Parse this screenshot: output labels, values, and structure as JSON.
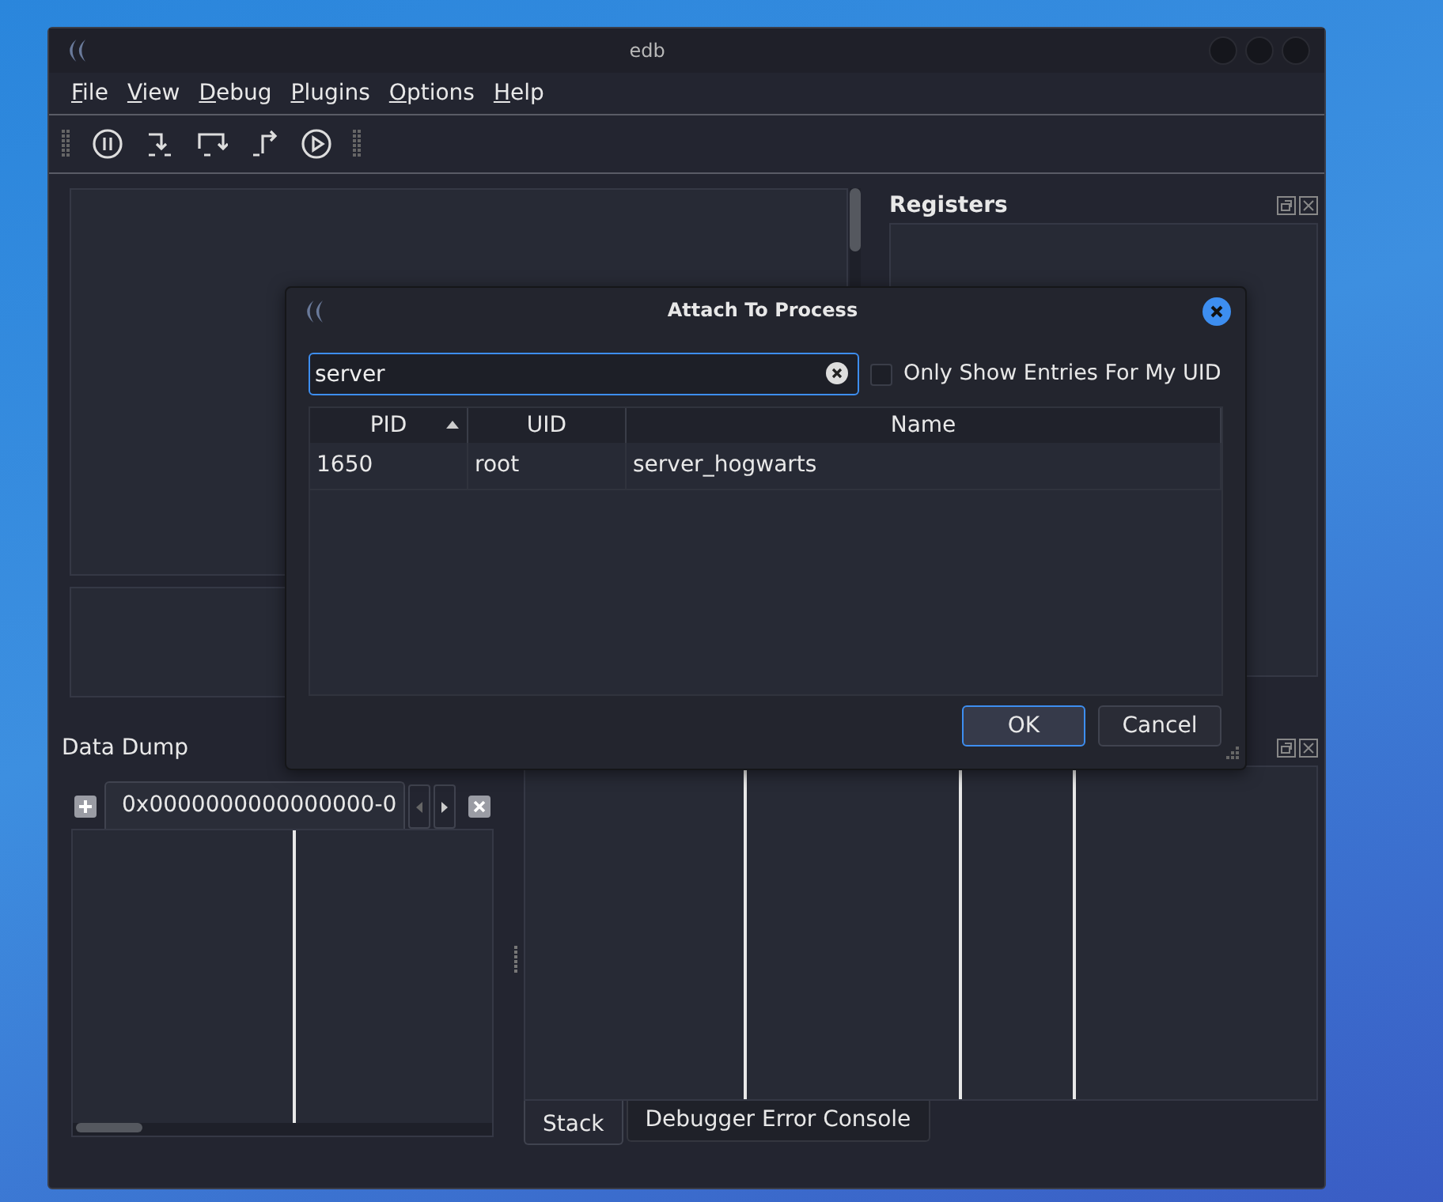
{
  "window": {
    "title": "edb"
  },
  "menu": [
    {
      "label": "File"
    },
    {
      "label": "View"
    },
    {
      "label": "Debug"
    },
    {
      "label": "Plugins"
    },
    {
      "label": "Options"
    },
    {
      "label": "Help"
    }
  ],
  "registers": {
    "title": "Registers"
  },
  "data_dump": {
    "title": "Data Dump",
    "tabs": [
      {
        "label": "0x0000000000000000-0",
        "selected": true
      }
    ]
  },
  "bottom_tabs": [
    {
      "label": "Stack",
      "selected": true
    },
    {
      "label": "Debugger Error Console",
      "selected": false
    }
  ],
  "dialog": {
    "title": "Attach To Process",
    "search": {
      "value": "server"
    },
    "filter": {
      "label": "Only Show Entries For My UID",
      "checked": false
    },
    "table": {
      "columns": [
        {
          "label": "PID",
          "sorted": true
        },
        {
          "label": "UID",
          "sorted": false
        },
        {
          "label": "Name",
          "sorted": false
        }
      ],
      "rows": [
        [
          "1650",
          "root",
          "server_hogwarts"
        ]
      ]
    },
    "buttons": [
      {
        "label": "OK",
        "default": true
      },
      {
        "label": "Cancel",
        "default": false
      }
    ]
  }
}
